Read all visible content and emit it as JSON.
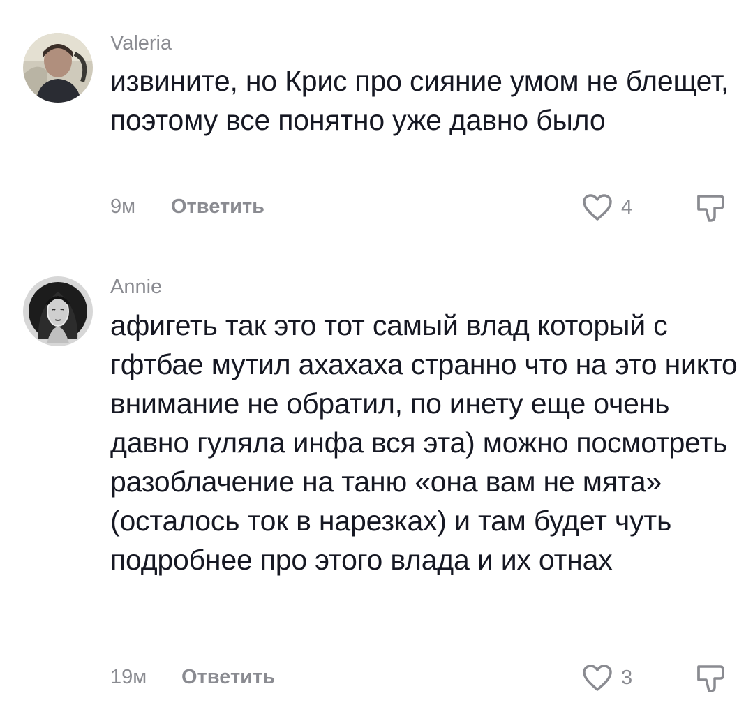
{
  "comments": [
    {
      "username": "Valeria",
      "text": "извините, но Крис про сияние умом не блещет, поэтому все понятно уже давно было",
      "time": "9м",
      "reply_label": "Ответить",
      "likes": "4",
      "avatar_icon": "user-photo-avatar",
      "like_icon": "heart-outline-icon",
      "dislike_icon": "thumbs-down-icon"
    },
    {
      "username": "Annie",
      "text": "афигеть так это тот самый влад который с гфтбае мутил ахахаха странно что на это никто внимание не обратил, по инету еще очень давно гуляла инфа вся эта) можно посмотреть разоблачение на таню «она вам не мята» (осталось ток в нарезках) и там будет чуть подробнее про этого влада и их отнах",
      "time": "19м",
      "reply_label": "Ответить",
      "likes": "3",
      "avatar_icon": "engraving-portrait-avatar",
      "like_icon": "heart-outline-icon",
      "dislike_icon": "thumbs-down-icon"
    }
  ],
  "colors": {
    "text_primary": "#161823",
    "text_secondary": "#8a8b91",
    "background": "#ffffff"
  }
}
